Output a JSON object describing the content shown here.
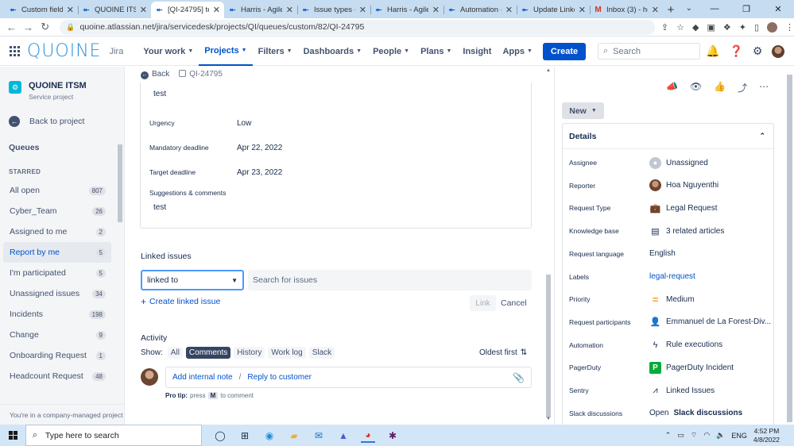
{
  "browser": {
    "tabs": [
      {
        "title": "Custom fields",
        "icon": "atlassian-icon",
        "active": false
      },
      {
        "title": "QUOINE ITSM",
        "icon": "atlassian-icon",
        "active": false
      },
      {
        "title": "[QI-24795] te...",
        "icon": "atlassian-icon",
        "active": true
      },
      {
        "title": "Harris - Agile",
        "icon": "atlassian-icon",
        "active": false
      },
      {
        "title": "Issue types -",
        "icon": "atlassian-icon",
        "active": false
      },
      {
        "title": "Harris - Agile",
        "icon": "atlassian-icon",
        "active": false
      },
      {
        "title": "Automation -",
        "icon": "atlassian-icon",
        "active": false
      },
      {
        "title": "Update Linke...",
        "icon": "atlassian-icon",
        "active": false
      },
      {
        "title": "Inbox (3) - ho...",
        "icon": "gmail-icon",
        "active": false
      }
    ],
    "url": "quoine.atlassian.net/jira/servicedesk/projects/QI/queues/custom/82/QI-24795"
  },
  "topnav": {
    "logo": "QUOINE",
    "product": "Jira",
    "items": [
      {
        "label": "Your work",
        "active": false
      },
      {
        "label": "Projects",
        "active": true
      },
      {
        "label": "Filters",
        "active": false
      },
      {
        "label": "Dashboards",
        "active": false
      },
      {
        "label": "People",
        "active": false
      },
      {
        "label": "Plans",
        "active": false
      },
      {
        "label": "Insight",
        "active": false
      },
      {
        "label": "Apps",
        "active": false
      }
    ],
    "create_label": "Create",
    "search_placeholder": "Search"
  },
  "sidebar": {
    "project_name": "QUOINE ITSM",
    "project_type": "Service project",
    "back_label": "Back to project",
    "queues_title": "Queues",
    "starred_label": "STARRED",
    "queues": [
      {
        "label": "All open",
        "count": "807",
        "active": false
      },
      {
        "label": "Cyber_Team",
        "count": "26",
        "active": false
      },
      {
        "label": "Assigned to me",
        "count": "2",
        "active": false
      },
      {
        "label": "Report by me",
        "count": "5",
        "active": true
      },
      {
        "label": "I'm participated",
        "count": "5",
        "active": false
      },
      {
        "label": "Unassigned issues",
        "count": "34",
        "active": false
      },
      {
        "label": "Incidents",
        "count": "198",
        "active": false
      },
      {
        "label": "Change",
        "count": "9",
        "active": false
      },
      {
        "label": "Onboarding Request",
        "count": "1",
        "active": false
      },
      {
        "label": "Headcount Request",
        "count": "48",
        "active": false
      }
    ],
    "footer": "You're in a company-managed project"
  },
  "main": {
    "back_label": "Back",
    "issue_key": "QI-24795",
    "fields": {
      "top_value": "test",
      "urgency_label": "Urgency",
      "urgency_value": "Low",
      "mandatory_label": "Mandatory deadline",
      "mandatory_value": "Apr 22, 2022",
      "target_label": "Target deadline",
      "target_value": "Apr 23, 2022",
      "suggestions_label": "Suggestions & comments",
      "suggestions_value": "test"
    },
    "linked": {
      "title": "Linked issues",
      "link_type": "linked to",
      "search_placeholder": "Search for issues",
      "create_label": "Create linked issue",
      "link_button": "Link",
      "cancel_button": "Cancel"
    },
    "activity": {
      "title": "Activity",
      "show_label": "Show:",
      "filters": [
        {
          "label": "All",
          "selected": false
        },
        {
          "label": "Comments",
          "selected": true
        },
        {
          "label": "History",
          "selected": false
        },
        {
          "label": "Work log",
          "selected": false
        },
        {
          "label": "Slack",
          "selected": false
        }
      ],
      "sort_label": "Oldest first",
      "add_internal_note": "Add internal note",
      "separator": "/",
      "reply_to_customer": "Reply to customer",
      "protip_prefix": "Pro tip:",
      "protip_press": "press",
      "protip_key": "M",
      "protip_suffix": "to comment"
    }
  },
  "right": {
    "status": "New",
    "details_title": "Details",
    "details": [
      {
        "label": "Assignee",
        "value": "Unassigned",
        "icon": "user-icon"
      },
      {
        "label": "Reporter",
        "value": "Hoa Nguyenthi",
        "icon": "avatar-icon"
      },
      {
        "label": "Request Type",
        "value": "Legal Request",
        "icon": "briefcase-icon"
      },
      {
        "label": "Knowledge base",
        "value": "3 related articles",
        "icon": "article-icon"
      },
      {
        "label": "Request language",
        "value": "English",
        "icon": ""
      },
      {
        "label": "Labels",
        "value": "legal-request",
        "icon": ""
      },
      {
        "label": "Priority",
        "value": "Medium",
        "icon": "priority-medium-icon"
      },
      {
        "label": "Request participants",
        "value": "Emmanuel de La Forest-Div...",
        "icon": "participant-icon"
      },
      {
        "label": "Automation",
        "value": "Rule executions",
        "icon": "lightning-icon"
      },
      {
        "label": "PagerDuty",
        "value": "PagerDuty Incident",
        "icon": "pagerduty-icon"
      },
      {
        "label": "Sentry",
        "value": "Linked Issues",
        "icon": "sentry-icon"
      },
      {
        "label": "Slack discussions",
        "value_prefix": "Open",
        "value": "Slack discussions",
        "icon": ""
      }
    ]
  },
  "taskbar": {
    "search_placeholder": "Type here to search",
    "time": "4:52 PM",
    "date": "4/8/2022"
  },
  "colors": {
    "accent": "#0052cc",
    "create_button": "#0052cc",
    "logo": "#2a8fd9",
    "priority_medium": "#ff991f",
    "pagerduty": "#06ac38"
  }
}
